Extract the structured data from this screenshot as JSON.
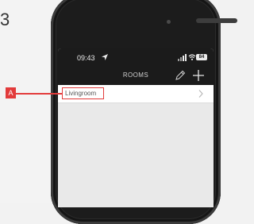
{
  "corner_glyph": "3",
  "status_bar": {
    "time": "09:43",
    "battery": "84",
    "location_icon": "location-arrow-icon",
    "signal_icon": "signal-icon",
    "wifi_icon": "wifi-icon"
  },
  "nav": {
    "title": "ROOMS",
    "edit_icon": "pencil-icon",
    "add_icon": "plus-icon"
  },
  "rooms": [
    {
      "label": "Livingroom",
      "chevron_icon": "chevron-right-icon"
    }
  ],
  "annotation": {
    "tag": "A",
    "color": "#e23b3b"
  }
}
